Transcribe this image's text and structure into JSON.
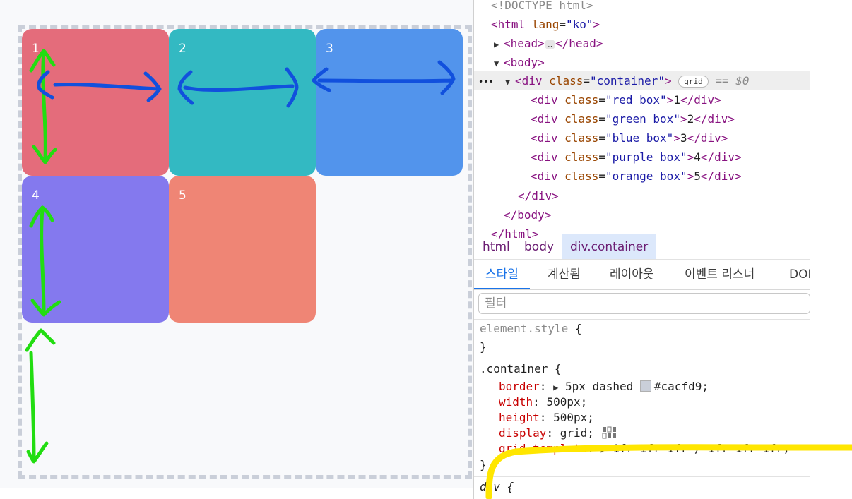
{
  "preview": {
    "boxes": [
      {
        "label": "1",
        "color": "#e46c7b"
      },
      {
        "label": "2",
        "color": "#33b9c2"
      },
      {
        "label": "3",
        "color": "#5294ec"
      },
      {
        "label": "4",
        "color": "#8479ee"
      },
      {
        "label": "5",
        "color": "#ef8575"
      }
    ],
    "annotation_colors": {
      "row_arrows": "#22dd11",
      "column_arrows": "#1150dd",
      "highlight": "#ffe600"
    }
  },
  "dom": {
    "doctype": "<!DOCTYPE html>",
    "html_open": "<html",
    "html_lang_attr": "lang",
    "html_lang_val": "\"ko\"",
    "html_close_bracket": ">",
    "head_open": "<head>",
    "head_dots": "…",
    "head_close": "</head>",
    "body_open": "<body>",
    "container_open": "<div",
    "container_attr": "class",
    "container_val": "\"container\"",
    "container_bracket": ">",
    "grid_badge": "grid",
    "eq_sel": "== $0",
    "children": [
      {
        "open": "<div",
        "attr": "class",
        "val": "\"red box\"",
        "gt": ">",
        "text": "1",
        "close": "</div>"
      },
      {
        "open": "<div",
        "attr": "class",
        "val": "\"green box\"",
        "gt": ">",
        "text": "2",
        "close": "</div>"
      },
      {
        "open": "<div",
        "attr": "class",
        "val": "\"blue box\"",
        "gt": ">",
        "text": "3",
        "close": "</div>"
      },
      {
        "open": "<div",
        "attr": "class",
        "val": "\"purple box\"",
        "gt": ">",
        "text": "4",
        "close": "</div>"
      },
      {
        "open": "<div",
        "attr": "class",
        "val": "\"orange box\"",
        "gt": ">",
        "text": "5",
        "close": "</div>"
      }
    ],
    "div_close": "</div>",
    "body_close": "</body>",
    "html_close": "</html>",
    "row_menu": "•••"
  },
  "breadcrumb": [
    "html",
    "body",
    "div.container"
  ],
  "tabs": [
    "스타일",
    "계산됨",
    "레이아웃",
    "이벤트 리스너",
    "DOM"
  ],
  "filter_placeholder": "필터",
  "styles": {
    "element_style_selector": "element.style",
    "open_brace": "{",
    "close_brace": "}",
    "container_selector": ".container",
    "rules": [
      {
        "prop": "border",
        "value": "5px dashed",
        "color_value": "#cacfd9"
      },
      {
        "prop": "width",
        "value": "500px"
      },
      {
        "prop": "height",
        "value": "500px"
      },
      {
        "prop": "display",
        "value": "grid"
      },
      {
        "prop": "grid-template",
        "value": "1fr 1fr 1fr / 1fr 1fr 1fr"
      }
    ],
    "next_selector": "div {"
  }
}
